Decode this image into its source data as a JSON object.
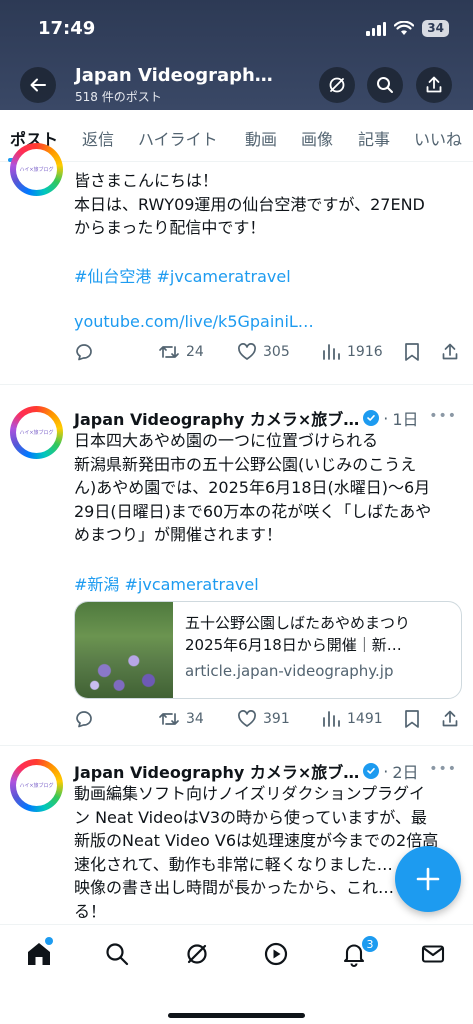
{
  "status_bar": {
    "time": "17:49",
    "battery": "34"
  },
  "header": {
    "account_name": "Japan Videograph…",
    "post_count": "518 件のポスト",
    "icons": [
      "back-arrow-icon",
      "grok-icon",
      "search-icon",
      "share-icon"
    ]
  },
  "tabs": [
    "ポスト",
    "返信",
    "ハイライト",
    "動画",
    "画像",
    "記事",
    "いいね"
  ],
  "active_tab": "ポスト",
  "tweets": [
    {
      "text_lines": [
        "皆さまこんにちは！",
        "本日は、RWY09運用の仙台空港ですが、27END",
        "からまったり配信中です！"
      ],
      "hashtags": "#仙台空港 #jvcameratravel",
      "link": "youtube.com/live/k5GpainiL…",
      "retweets": "24",
      "likes": "305",
      "views": "1916"
    },
    {
      "author": "Japan Videography カメラ×旅ブ…",
      "time": "1日",
      "text_lines": [
        "日本四大あやめ園の一つに位置づけられる",
        "新潟県新発田市の五十公野公園(いじみのこうえ",
        "ん)あやめ園では、2025年6月18日(水曜日)〜6月",
        "29日(日曜日)まで60万本の花が咲く「しばたあや",
        "めまつり」が開催されます！"
      ],
      "hashtags": "#新潟 #jvcameratravel",
      "card": {
        "title_line1": "五十公野公園しばたあやめまつり",
        "title_line2": "2025年6月18日から開催｜新…",
        "domain": "article.japan-videography.jp"
      },
      "retweets": "34",
      "likes": "391",
      "views": "1491"
    },
    {
      "author": "Japan Videography カメラ×旅ブ…",
      "time": "2日",
      "text_lines": [
        "動画編集ソフト向けノイズリダクションプラグイ",
        "ン Neat VideoはV3の時から使っていますが、最",
        "新版のNeat Video V6は処理速度が今までの2倍高",
        "速化されて、動作も非常に軽くなりました…",
        "映像の書き出し時間が長かったから、これ…",
        "る！"
      ]
    }
  ],
  "avatar_label": "ハイ×旅ブログ",
  "bottom_nav": {
    "items": [
      "home-icon",
      "search-icon",
      "grok-icon",
      "video-icon",
      "notifications-icon",
      "messages-icon"
    ],
    "notification_count": "3"
  },
  "colors": {
    "accent": "#1d9bf0",
    "header_bg": "#2d3a55",
    "secondary_text": "#536471"
  }
}
